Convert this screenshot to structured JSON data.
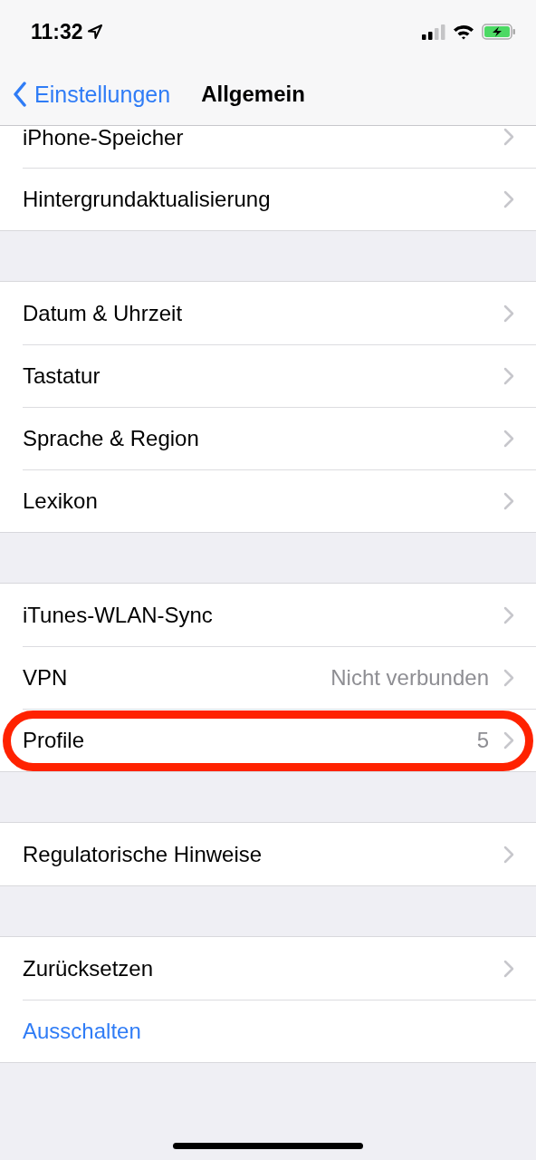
{
  "status_bar": {
    "time": "11:32"
  },
  "nav_bar": {
    "back": "Einstellungen",
    "title": "Allgemein"
  },
  "groups": [
    {
      "items": [
        {
          "label": "iPhone-Speicher",
          "kind": "link",
          "highlighted": false
        },
        {
          "label": "Hintergrundaktualisierung",
          "kind": "link",
          "highlighted": false
        }
      ]
    },
    {
      "items": [
        {
          "label": "Datum & Uhrzeit",
          "kind": "link",
          "highlighted": false
        },
        {
          "label": "Tastatur",
          "kind": "link",
          "highlighted": false
        },
        {
          "label": "Sprache & Region",
          "kind": "link",
          "highlighted": false
        },
        {
          "label": "Lexikon",
          "kind": "link",
          "highlighted": false
        }
      ]
    },
    {
      "items": [
        {
          "label": "iTunes-WLAN-Sync",
          "kind": "link",
          "highlighted": false
        },
        {
          "label": "VPN",
          "value": "Nicht verbunden",
          "kind": "link",
          "highlighted": false
        },
        {
          "label": "Profile",
          "value": "5",
          "kind": "link",
          "highlighted": true
        }
      ]
    },
    {
      "items": [
        {
          "label": "Regulatorische Hinweise",
          "kind": "link",
          "highlighted": false
        }
      ]
    },
    {
      "items": [
        {
          "label": "Zurücksetzen",
          "kind": "link",
          "highlighted": false
        },
        {
          "label": "Ausschalten",
          "kind": "action",
          "highlighted": false
        }
      ]
    }
  ]
}
